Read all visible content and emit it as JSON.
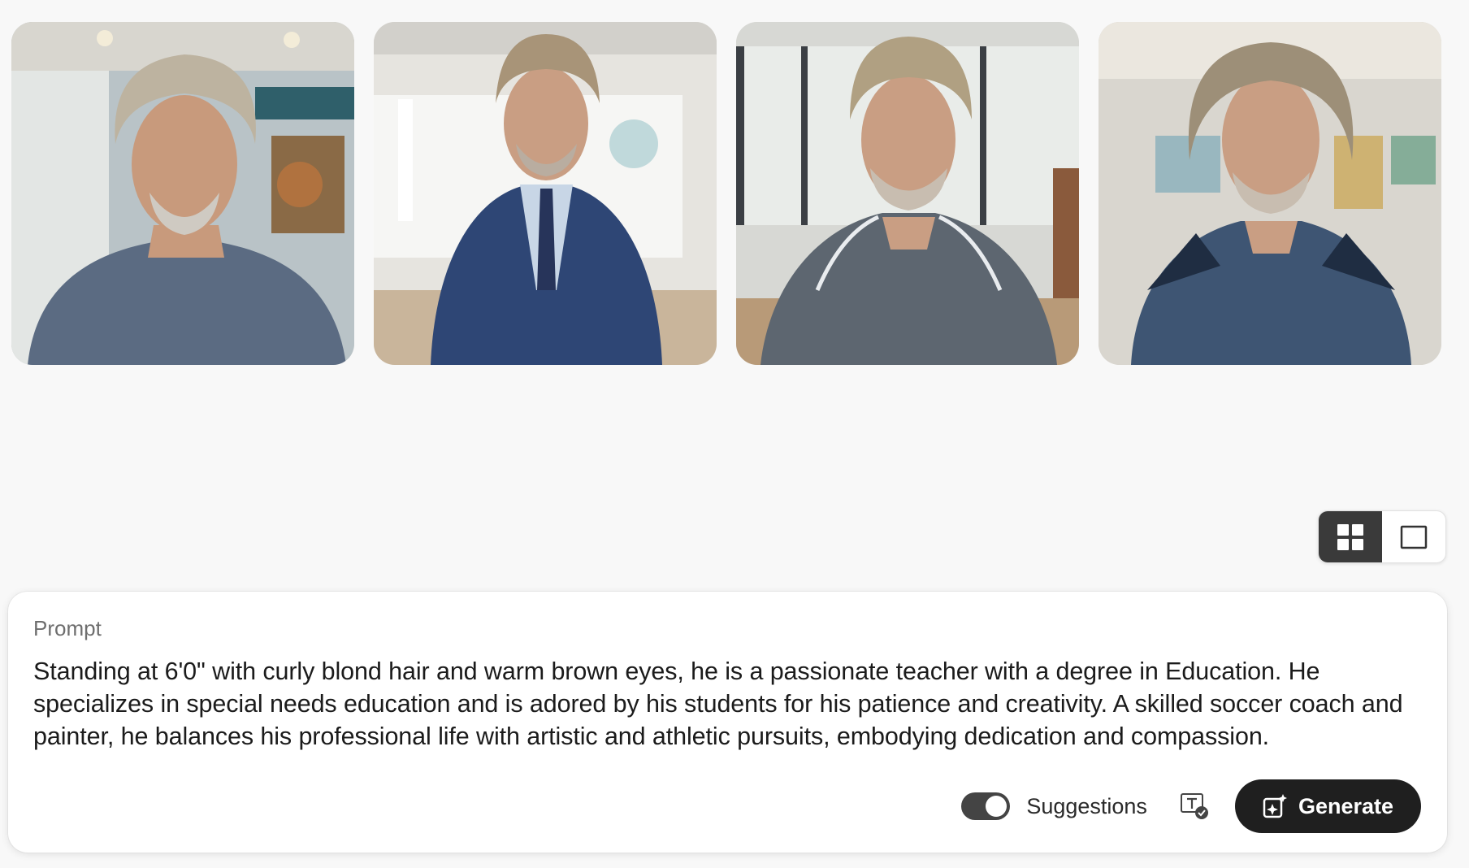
{
  "gallery": {
    "images": [
      {
        "name": "generated-image-1",
        "alt": "Man with curly gray hair in gray button shirt, classroom background",
        "shirt": "#5b6b82",
        "bg": "#b9c3c7",
        "accent": "#2f5f6a"
      },
      {
        "name": "generated-image-2",
        "alt": "Man with curly hair in navy suit and tie, whiteboard background",
        "shirt": "#2e4675",
        "bg": "#e6e4df",
        "accent": "#ffffff"
      },
      {
        "name": "generated-image-3",
        "alt": "Man with curly hair in gray polo, bright classroom background",
        "shirt": "#5d6670",
        "bg": "#d7d8d4",
        "accent": "#a9b2a5"
      },
      {
        "name": "generated-image-4",
        "alt": "Man with curly hair in navy polo, maps on wall background",
        "shirt": "#3e5573",
        "bg": "#d9d6cf",
        "accent": "#7ea9b8"
      }
    ]
  },
  "view_toggle": {
    "grid": {
      "icon": "grid-icon",
      "active": true
    },
    "single": {
      "icon": "single-view-icon",
      "active": false
    }
  },
  "prompt": {
    "label": "Prompt",
    "text": "Standing at 6'0\" with curly blond hair and warm brown eyes, he is a passionate teacher with a degree in Education. He specializes in special needs education and is adored by his students for his patience and creativity. A skilled soccer coach and painter, he balances his professional life with artistic and athletic pursuits, embodying dedication and compassion."
  },
  "controls": {
    "suggestions_label": "Suggestions",
    "suggestions_on": true,
    "generate_label": "Generate"
  },
  "colors": {
    "accent_dark": "#1f1f1f",
    "toggle_on": "#444444",
    "background": "#f8f8f8"
  }
}
